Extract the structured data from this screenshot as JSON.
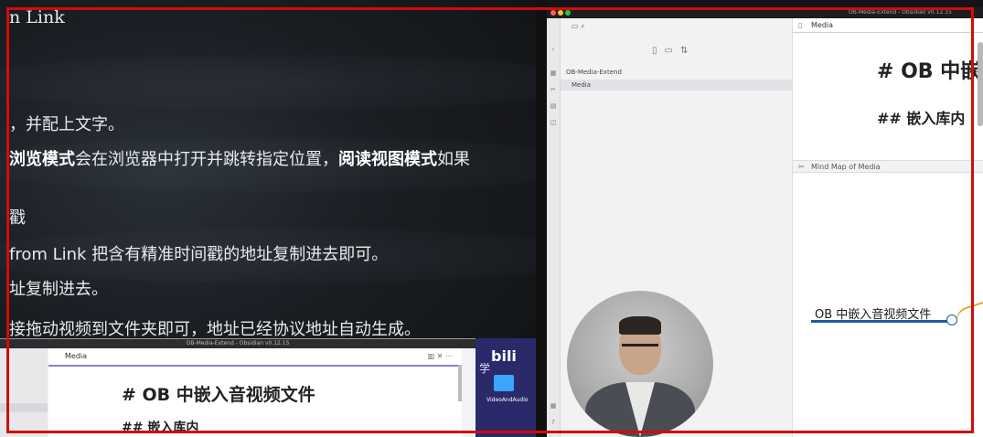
{
  "left_panel": {
    "lines": [
      {
        "text": "n Link"
      },
      {
        "text": "，并配上文字。"
      },
      {
        "bold1": "浏览模式",
        "mid": "会在浏览器中打开并跳转指定位置，",
        "bold2": "阅读视图模式",
        "tail": "如果"
      },
      {
        "text": "戳"
      },
      {
        "text": "from Link 把含有精准时间戳的地址复制进去即可。"
      },
      {
        "text": "址复制进去。"
      },
      {
        "text": "接拖动视频到文件夹即可，地址已经协议地址自动生成。"
      }
    ],
    "mini_window": {
      "title": "OB-Media-Extend - Obsidian v0.12.15",
      "tab": "Media",
      "tab_icons": "▥ ✕ ⋯",
      "h1": "# OB 中嵌入音视频文件",
      "h2": "## 嵌入库内"
    },
    "bili": {
      "logo": "bili",
      "side_char": "学",
      "folder_label": "VideoAndAudio"
    }
  },
  "obsidian": {
    "title": "OB-Media-Extend - Obsidian v0.12.15",
    "file_pane": {
      "top_icons": "▭  ⌕",
      "toolbar_icons": "▯▭⇅",
      "vault_name": "OB-Media-Extend",
      "selected_folder": "Media"
    },
    "ribbon_icons": [
      "‹",
      "▦",
      "✂",
      "▤",
      "◫",
      "▦",
      "?"
    ],
    "editor": {
      "tab_icon": "▯",
      "tab": "Media",
      "h1": "# OB 中嵌入",
      "h2": "## 嵌入库内"
    },
    "mindmap": {
      "icon": "✂",
      "header": "Mind Map of Media",
      "node": "OB 中嵌入音视频文件"
    }
  },
  "colors": {
    "capture_frame": "#d30b0b",
    "accent": "#8a7cd6",
    "mindmap_line": "#1d5b9b",
    "mindmap_branch": "#e4a11b"
  }
}
